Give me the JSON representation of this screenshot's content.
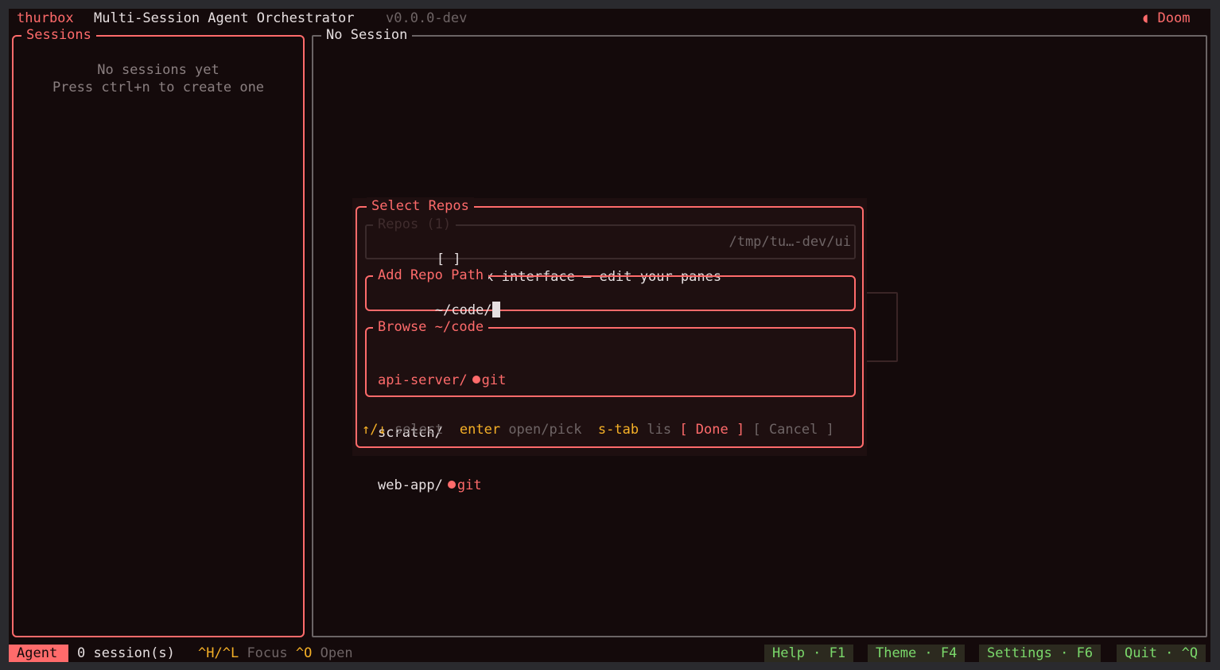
{
  "header": {
    "app_name": "thurbox",
    "subtitle": "Multi-Session Agent Orchestrator",
    "version": "v0.0.0-dev",
    "theme_icon": "moon-icon",
    "theme_name": "Doom"
  },
  "sessions_panel": {
    "title": "Sessions",
    "empty_line1": "No sessions yet",
    "empty_line2": "Press ctrl+n to create one"
  },
  "main_panel": {
    "title": "No Session"
  },
  "dialog": {
    "title": "Select Repos",
    "repos_section": {
      "title": "Repos (1)",
      "items": [
        {
          "checkbox": "[ ]",
          "label": "Thurbox interface — edit your panes",
          "path": "/tmp/tu…-dev/ui"
        }
      ]
    },
    "add_path": {
      "title": "Add Repo Path",
      "value": "~/code/"
    },
    "browse": {
      "title": "Browse ~/code",
      "items": [
        {
          "name": "api-server/",
          "badge": "git"
        },
        {
          "name": "scratch/",
          "badge": ""
        },
        {
          "name": "web-app/",
          "badge": "git"
        }
      ]
    },
    "hints": {
      "k1": "↑/↓",
      "a1": "select",
      "k2": "enter",
      "a2": "open/pick",
      "k3": "s-tab",
      "a3": "lis"
    },
    "done_label": "[ Done ]",
    "cancel_label": "[ Cancel ]"
  },
  "status_bar": {
    "mode": "Agent",
    "session_count": "0 session(s)",
    "k_focus": "^H/^L",
    "a_focus": "Focus",
    "k_open": "^O",
    "a_open": "Open",
    "help": "Help · F1",
    "theme": "Theme · F4",
    "settings": "Settings · F6",
    "quit": "Quit · ^Q"
  },
  "colors": {
    "accent": "#ff6b6b",
    "background": "#140a0b",
    "key_hint": "#f5b027",
    "function_key": "#7bd96b"
  }
}
